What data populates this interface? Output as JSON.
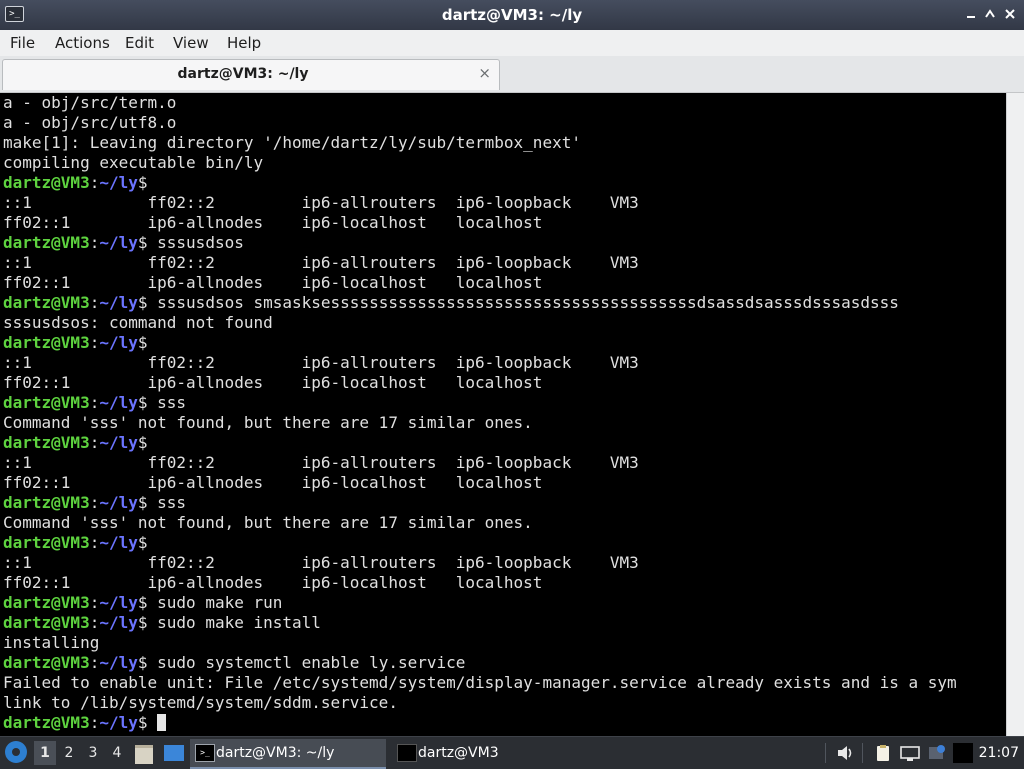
{
  "window": {
    "title": "dartz@VM3: ~/ly",
    "app_icon_glyph": ">_",
    "icons": [
      "terminal-app-icon",
      "minimize-icon",
      "maximize-icon",
      "close-icon"
    ]
  },
  "menu": {
    "file": "File",
    "actions": "Actions",
    "edit": "Edit",
    "view": "View",
    "help": "Help"
  },
  "tab": {
    "label": "dartz@VM3: ~/ly",
    "close_glyph": "×"
  },
  "terminal": {
    "prompt_user": "dartz@VM3",
    "prompt_sep": ":",
    "prompt_path": "~/ly",
    "prompt_end": "$",
    "colors": {
      "background": "#000000",
      "text": "#e0e0e0",
      "user": "#5ed33f",
      "path": "#6b74ff"
    },
    "lines": [
      {
        "text": "a - obj/src/term.o"
      },
      {
        "text": "a - obj/src/utf8.o"
      },
      {
        "text": "make[1]: Leaving directory '/home/dartz/ly/sub/termbox_next'"
      },
      {
        "text": "compiling executable bin/ly"
      },
      {
        "prompt": true,
        "cmd": ""
      },
      {
        "text": "::1            ff02::2         ip6-allrouters  ip6-loopback    VM3"
      },
      {
        "text": "ff02::1        ip6-allnodes    ip6-localhost   localhost"
      },
      {
        "prompt": true,
        "cmd": " sssusdsos"
      },
      {
        "text": "::1            ff02::2         ip6-allrouters  ip6-loopback    VM3"
      },
      {
        "text": "ff02::1        ip6-allnodes    ip6-localhost   localhost"
      },
      {
        "prompt": true,
        "cmd": " sssusdsos smsasksessssssssssssssssssssssssssssssssssssssdsassdsasssdsssasdsss"
      },
      {
        "text": "sssusdsos: command not found"
      },
      {
        "prompt": true,
        "cmd": ""
      },
      {
        "text": "::1            ff02::2         ip6-allrouters  ip6-loopback    VM3"
      },
      {
        "text": "ff02::1        ip6-allnodes    ip6-localhost   localhost"
      },
      {
        "prompt": true,
        "cmd": " sss"
      },
      {
        "text": "Command 'sss' not found, but there are 17 similar ones."
      },
      {
        "prompt": true,
        "cmd": ""
      },
      {
        "text": "::1            ff02::2         ip6-allrouters  ip6-loopback    VM3"
      },
      {
        "text": "ff02::1        ip6-allnodes    ip6-localhost   localhost"
      },
      {
        "prompt": true,
        "cmd": " sss"
      },
      {
        "text": "Command 'sss' not found, but there are 17 similar ones."
      },
      {
        "prompt": true,
        "cmd": ""
      },
      {
        "text": "::1            ff02::2         ip6-allrouters  ip6-loopback    VM3"
      },
      {
        "text": "ff02::1        ip6-allnodes    ip6-localhost   localhost"
      },
      {
        "prompt": true,
        "cmd": " sudo make run"
      },
      {
        "prompt": true,
        "cmd": " sudo make install"
      },
      {
        "text": "installing"
      },
      {
        "prompt": true,
        "cmd": " sudo systemctl enable ly.service"
      },
      {
        "text": "Failed to enable unit: File /etc/systemd/system/display-manager.service already exists and is a sym"
      },
      {
        "text": "link to /lib/systemd/system/sddm.service."
      },
      {
        "prompt": true,
        "cmd": " ",
        "cursor": true
      }
    ]
  },
  "taskbar": {
    "workspaces": [
      "1",
      "2",
      "3",
      "4"
    ],
    "active_workspace": "1",
    "tasks": [
      {
        "label": "dartz@VM3: ~/ly",
        "active": true
      },
      {
        "label": "dartz@VM3",
        "active": false
      }
    ],
    "clock": "21:07",
    "icons": [
      "start-menu-icon",
      "file-manager-icon",
      "show-desktop-icon",
      "volume-icon",
      "clipboard-icon",
      "network-icon",
      "update-notifier-icon",
      "terminal-tray-icon"
    ]
  }
}
